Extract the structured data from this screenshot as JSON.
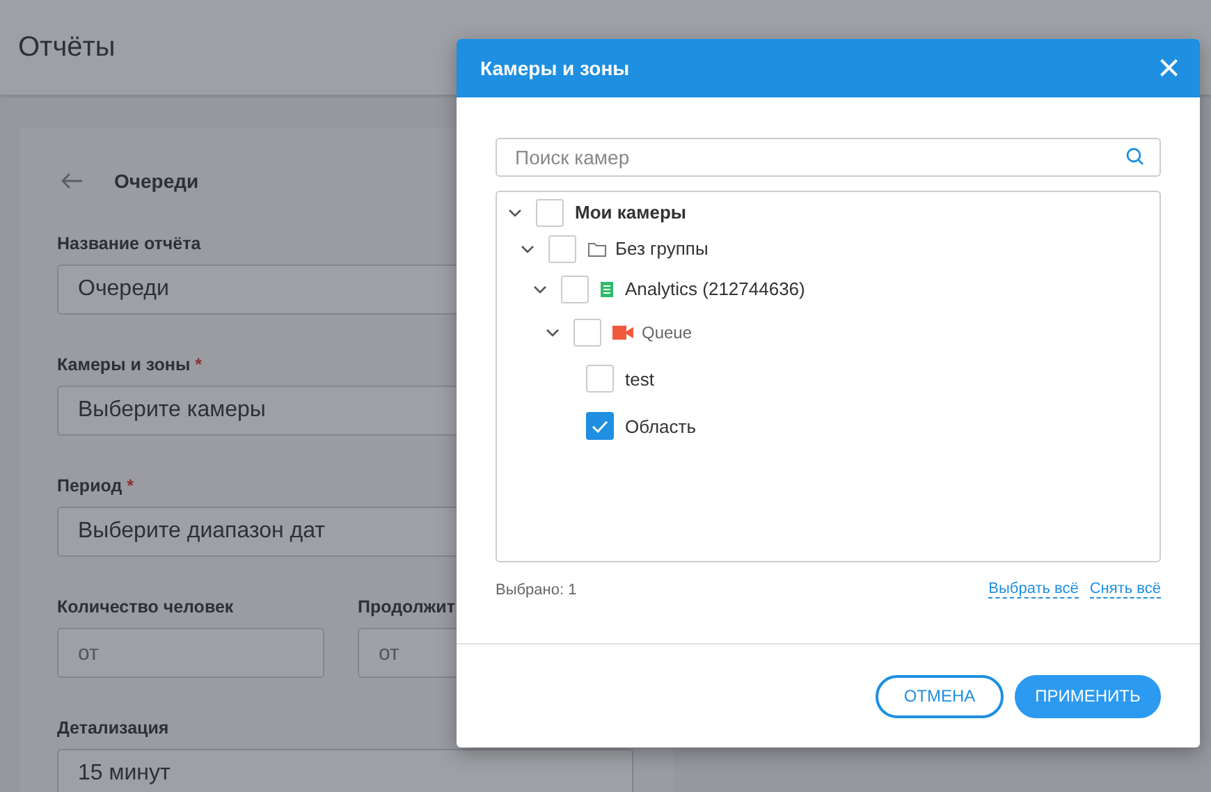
{
  "page": {
    "title": "Отчёты",
    "back_title": "Очереди",
    "required_sign": "*",
    "fields": [
      {
        "kind": "full",
        "label": "Название отчёта",
        "required": false,
        "value": "Очереди"
      },
      {
        "kind": "full",
        "label": "Камеры и зоны",
        "required": true,
        "value": "Выберите камеры"
      },
      {
        "kind": "full",
        "label": "Период",
        "required": true,
        "value": "Выберите диапазон дат"
      },
      {
        "kind": "pair",
        "items": [
          {
            "label": "Количество человек",
            "placeholder": "от"
          },
          {
            "label": "Продолжит",
            "placeholder": "от"
          }
        ]
      },
      {
        "kind": "full",
        "label": "Детализация",
        "required": false,
        "value": "15 минут"
      }
    ]
  },
  "dialog": {
    "title": "Камеры и зоны",
    "close": "×",
    "search": {
      "placeholder": "Поиск камер"
    },
    "tree": [
      {
        "kind": "group",
        "label": "Мои камеры",
        "checked": false,
        "expanded": true,
        "children": [
          {
            "kind": "folder",
            "label": "Без группы",
            "checked": false,
            "expanded": true,
            "children": [
              {
                "kind": "server",
                "label": "Analytics (212744636)",
                "checked": false,
                "expanded": true,
                "children": [
                  {
                    "kind": "camera",
                    "label": "Queue",
                    "checked": false,
                    "expanded": true,
                    "children": [
                      {
                        "kind": "zone",
                        "label": "test",
                        "checked": false
                      },
                      {
                        "kind": "zone",
                        "label": "Область",
                        "checked": true
                      }
                    ]
                  }
                ]
              }
            ]
          }
        ]
      }
    ],
    "selected_count": "Выбрано: 1",
    "select_all": "Выбрать всё",
    "clear_all": "Снять всё",
    "buttons": [
      {
        "kind": "outline",
        "label": "ОТМЕНА"
      },
      {
        "kind": "primary",
        "label": "ПРИМЕНИТЬ"
      }
    ]
  }
}
